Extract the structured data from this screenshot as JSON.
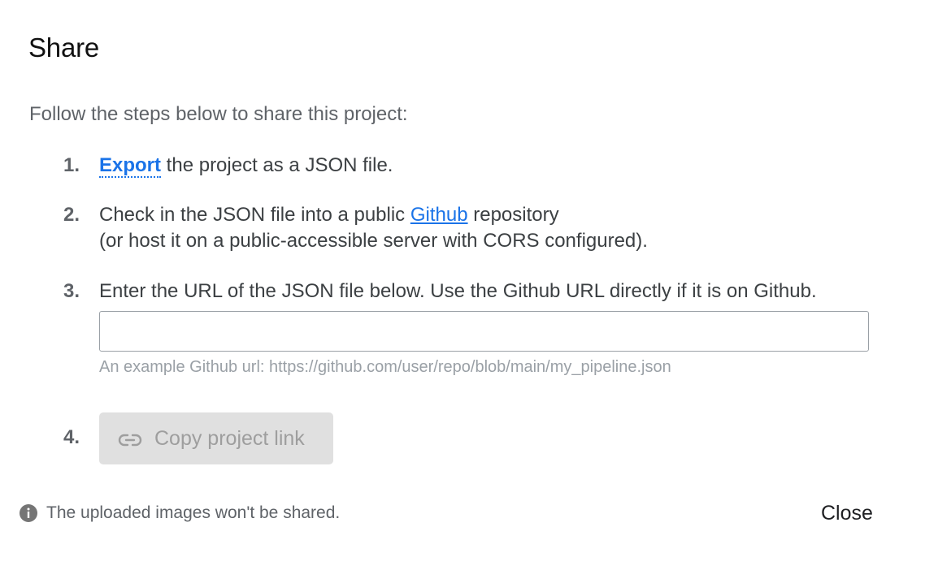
{
  "dialog": {
    "title": "Share",
    "intro": "Follow the steps below to share this project:"
  },
  "steps": [
    {
      "number": "1.",
      "link": "Export",
      "text_after": " the project as a JSON file."
    },
    {
      "number": "2.",
      "text_before": "Check in the JSON file into a public ",
      "link": "Github",
      "text_after": " repository",
      "line2": "(or host it on a public-accessible server with CORS configured)."
    },
    {
      "number": "3.",
      "text": "Enter the URL of the JSON file below. Use the Github URL directly if it is on Github.",
      "input_value": "",
      "input_placeholder": "",
      "hint": "An example Github url: https://github.com/user/repo/blob/main/my_pipeline.json"
    },
    {
      "number": "4.",
      "button_label": "Copy project link",
      "button_icon": "link-icon",
      "button_enabled": false
    }
  ],
  "footer": {
    "note_icon": "info-icon",
    "note": "The uploaded images won't be shared.",
    "close_label": "Close"
  },
  "colors": {
    "link": "#1a73e8",
    "disabled_button_bg": "#e0e0e0",
    "disabled_button_text": "#9e9e9e"
  }
}
